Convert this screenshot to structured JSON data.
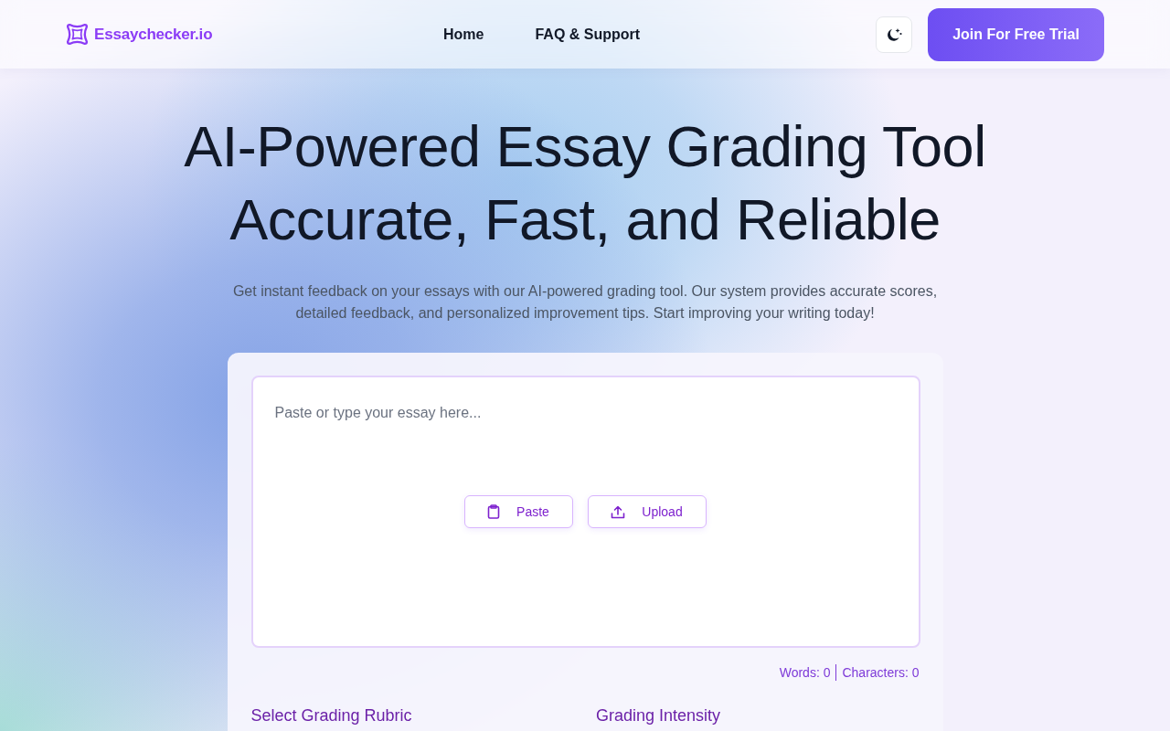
{
  "header": {
    "logo": "Essaychecker.io",
    "nav": [
      {
        "label": "Home"
      },
      {
        "label": "FAQ & Support"
      }
    ],
    "cta": "Join For Free Trial"
  },
  "hero": {
    "title_lines": [
      "AI-Powered Essay Grading Tool",
      "Accurate, Fast, and Reliable"
    ],
    "subtitle": "Get instant feedback on your essays with our AI-powered grading tool. Our system provides accurate scores, detailed feedback, and personalized improvement tips. Start improving your writing today!"
  },
  "editor": {
    "placeholder": "Paste or type your essay here...",
    "actions": [
      {
        "kind": "paste",
        "label": "Paste"
      },
      {
        "kind": "upload",
        "label": "Upload"
      }
    ],
    "words": "Words: 0",
    "characters": "Characters: 0"
  },
  "options": [
    {
      "heading": "Select Grading Rubric"
    },
    {
      "heading": "Grading Intensity"
    }
  ]
}
